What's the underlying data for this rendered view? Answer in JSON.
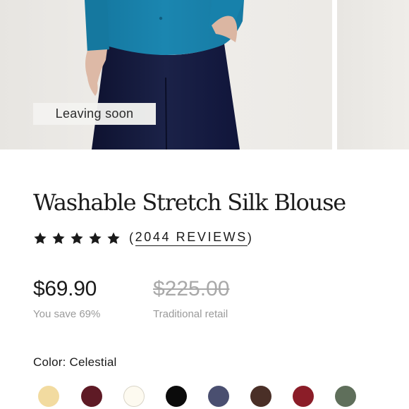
{
  "product": {
    "badge": "Leaving soon",
    "title": "Washable Stretch Silk Blouse",
    "rating": 5,
    "reviews_open": "(",
    "reviews_count": "2044 REVIEWS",
    "reviews_close": ")",
    "price": "$69.90",
    "savings": "You save 69%",
    "retail_price": "$225.00",
    "retail_label": "Traditional retail",
    "color_label": "Color: Celestial"
  },
  "swatches": [
    {
      "name": "sand",
      "color": "#f2dba0"
    },
    {
      "name": "burgundy",
      "color": "#5e1a25"
    },
    {
      "name": "ivory",
      "color": "#fdfaf0"
    },
    {
      "name": "black",
      "color": "#0b0b0b"
    },
    {
      "name": "navy",
      "color": "#4a4f70"
    },
    {
      "name": "brown",
      "color": "#4a2f27"
    },
    {
      "name": "red",
      "color": "#8b1d28"
    },
    {
      "name": "olive",
      "color": "#5f6f5b"
    }
  ],
  "colors": {
    "blouse": "#1a7fa7",
    "pants": "#121737",
    "star": "#1a1a1a"
  },
  "icons": [
    "star-icon"
  ]
}
